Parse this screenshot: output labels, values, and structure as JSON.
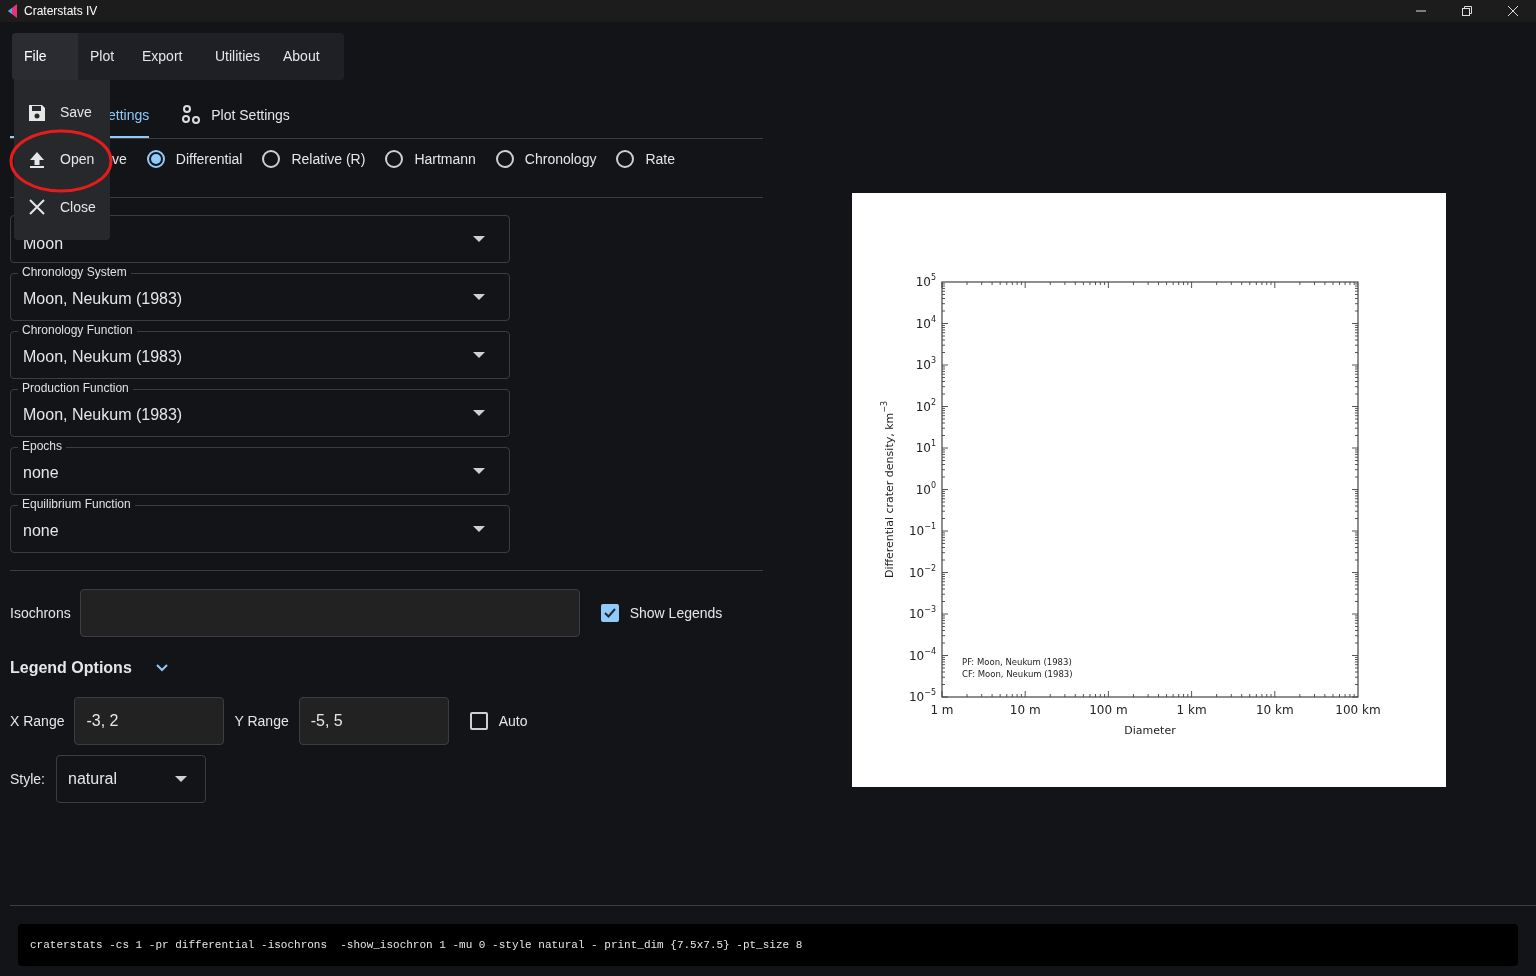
{
  "window": {
    "title": "Craterstats IV"
  },
  "menu_bar": [
    {
      "label": "File",
      "selected": true
    },
    {
      "label": "Plot",
      "selected": false
    },
    {
      "label": "Export",
      "selected": false
    },
    {
      "label": "Utilities",
      "selected": false
    },
    {
      "label": "About",
      "selected": false
    }
  ],
  "file_menu": [
    {
      "label": "Save",
      "kind": "save",
      "circled": false
    },
    {
      "label": "Open",
      "kind": "open",
      "circled": true
    },
    {
      "label": "Close",
      "kind": "close",
      "circled": false
    }
  ],
  "tabs": [
    {
      "label": "ettings",
      "selected": true,
      "kind": "partial"
    },
    {
      "label": "Plot Settings",
      "selected": false,
      "kind": "plot"
    }
  ],
  "plot_types": [
    {
      "label": "ve",
      "kind": "partial"
    },
    {
      "label": "Differential",
      "selected": true,
      "kind": "radio"
    },
    {
      "label": "Relative (R)",
      "selected": false,
      "kind": "radio"
    },
    {
      "label": "Hartmann",
      "selected": false,
      "kind": "radio"
    },
    {
      "label": "Chronology",
      "selected": false,
      "kind": "radio"
    },
    {
      "label": "Rate",
      "selected": false,
      "kind": "radio"
    }
  ],
  "fields": [
    {
      "value": "Moon"
    },
    {
      "label": "Chronology System",
      "value": "Moon, Neukum (1983)"
    },
    {
      "label": "Chronology Function",
      "value": "Moon, Neukum (1983)"
    },
    {
      "label": "Production Function",
      "value": "Moon, Neukum (1983)"
    },
    {
      "label": "Epochs",
      "value": "none"
    },
    {
      "label": "Equilibrium Function",
      "value": "none"
    }
  ],
  "isochrons": {
    "label": "Isochrons"
  },
  "show_legends": {
    "label": "Show Legends",
    "checked": true
  },
  "legend_options": {
    "title": "Legend Options",
    "expanded": true
  },
  "x_range": {
    "label": "X Range",
    "value": "-3, 2"
  },
  "y_range": {
    "label": "Y Range",
    "value": "-5, 5"
  },
  "auto": {
    "label": "Auto",
    "checked": false
  },
  "style": {
    "label": "Style:",
    "value": "natural"
  },
  "plot": {
    "xlabel": "Diameter",
    "ylabel": "Differential crater density, km$^{−3}$",
    "x_tick_labels": [
      "1 m",
      "10 m",
      "100 m",
      "1 km",
      "10 km",
      "100 km"
    ],
    "y_tick_labels": [
      "10$^{5}$",
      "10$^{4}$",
      "10$^{3}$",
      "10$^{2}$",
      "10$^{1}$",
      "10$^{0}$",
      "10$^{−1}$",
      "10$^{−2}$",
      "10$^{−3}$",
      "10$^{−4}$",
      "10$^{−5}$"
    ],
    "legend": [
      "PF: Moon, Neukum (1983)",
      "CF: Moon, Neukum (1983)"
    ]
  },
  "command": "craterstats -cs 1 -pr differential -isochrons  -show_isochron 1 -mu 0 -style natural - print_dim {7.5x7.5} -pt_size 8"
}
